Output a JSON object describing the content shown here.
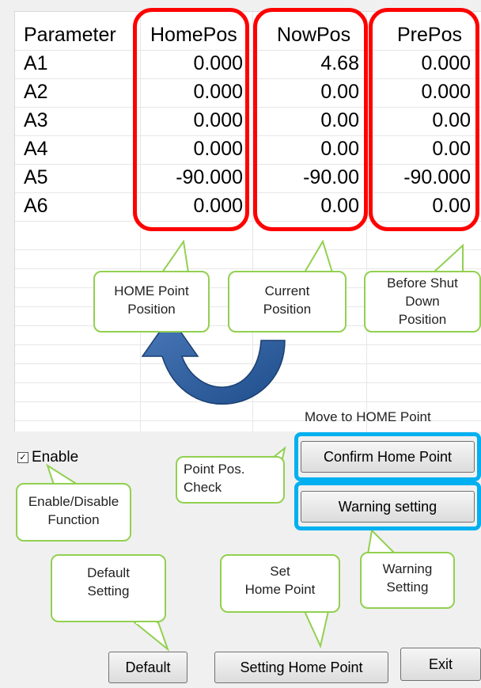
{
  "table": {
    "headers": [
      "Parameter",
      "HomePos",
      "NowPos",
      "PrePos"
    ],
    "rows": [
      {
        "param": "A1",
        "home": "0.000",
        "now": "4.68",
        "pre": "0.000"
      },
      {
        "param": "A2",
        "home": "0.000",
        "now": "0.00",
        "pre": "0.000"
      },
      {
        "param": "A3",
        "home": "0.000",
        "now": "0.00",
        "pre": "0.00"
      },
      {
        "param": "A4",
        "home": "0.000",
        "now": "0.00",
        "pre": "0.00"
      },
      {
        "param": "A5",
        "home": "-90.000",
        "now": "-90.00",
        "pre": "-90.000"
      },
      {
        "param": "A6",
        "home": "0.000",
        "now": "0.00",
        "pre": "0.00"
      }
    ]
  },
  "callouts": {
    "home_point_position": [
      "HOME Point",
      "Position"
    ],
    "current_position": [
      "Current",
      "Position"
    ],
    "before_shutdown": [
      "Before Shut",
      "Down",
      "Position"
    ],
    "point_pos_check": [
      "Point Pos.",
      "Check"
    ],
    "enable_disable": [
      "Enable/Disable",
      "Function"
    ],
    "default_setting": [
      "Default",
      "Setting"
    ],
    "set_home_point": [
      "Set",
      "Home Point"
    ],
    "warning_setting": [
      "Warning",
      "Setting"
    ]
  },
  "move_label": "Move to HOME Point",
  "enable": {
    "label": "Enable",
    "checked": true
  },
  "buttons": {
    "confirm_home": "Confirm Home Point",
    "warning_setting": "Warning setting",
    "default": "Default",
    "setting_home": "Setting Home Point",
    "exit": "Exit"
  },
  "colors": {
    "highlight_red": "#ff0000",
    "highlight_blue": "#00b0f0",
    "callout_green": "#92d050",
    "arrow_blue": "#2e5f9a"
  }
}
